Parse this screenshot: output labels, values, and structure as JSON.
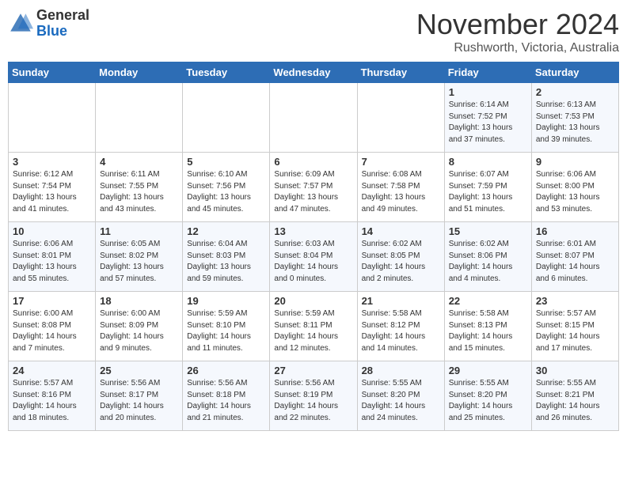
{
  "header": {
    "logo_general": "General",
    "logo_blue": "Blue",
    "month": "November 2024",
    "location": "Rushworth, Victoria, Australia"
  },
  "weekdays": [
    "Sunday",
    "Monday",
    "Tuesday",
    "Wednesday",
    "Thursday",
    "Friday",
    "Saturday"
  ],
  "weeks": [
    [
      {
        "day": "",
        "info": ""
      },
      {
        "day": "",
        "info": ""
      },
      {
        "day": "",
        "info": ""
      },
      {
        "day": "",
        "info": ""
      },
      {
        "day": "",
        "info": ""
      },
      {
        "day": "1",
        "info": "Sunrise: 6:14 AM\nSunset: 7:52 PM\nDaylight: 13 hours\nand 37 minutes."
      },
      {
        "day": "2",
        "info": "Sunrise: 6:13 AM\nSunset: 7:53 PM\nDaylight: 13 hours\nand 39 minutes."
      }
    ],
    [
      {
        "day": "3",
        "info": "Sunrise: 6:12 AM\nSunset: 7:54 PM\nDaylight: 13 hours\nand 41 minutes."
      },
      {
        "day": "4",
        "info": "Sunrise: 6:11 AM\nSunset: 7:55 PM\nDaylight: 13 hours\nand 43 minutes."
      },
      {
        "day": "5",
        "info": "Sunrise: 6:10 AM\nSunset: 7:56 PM\nDaylight: 13 hours\nand 45 minutes."
      },
      {
        "day": "6",
        "info": "Sunrise: 6:09 AM\nSunset: 7:57 PM\nDaylight: 13 hours\nand 47 minutes."
      },
      {
        "day": "7",
        "info": "Sunrise: 6:08 AM\nSunset: 7:58 PM\nDaylight: 13 hours\nand 49 minutes."
      },
      {
        "day": "8",
        "info": "Sunrise: 6:07 AM\nSunset: 7:59 PM\nDaylight: 13 hours\nand 51 minutes."
      },
      {
        "day": "9",
        "info": "Sunrise: 6:06 AM\nSunset: 8:00 PM\nDaylight: 13 hours\nand 53 minutes."
      }
    ],
    [
      {
        "day": "10",
        "info": "Sunrise: 6:06 AM\nSunset: 8:01 PM\nDaylight: 13 hours\nand 55 minutes."
      },
      {
        "day": "11",
        "info": "Sunrise: 6:05 AM\nSunset: 8:02 PM\nDaylight: 13 hours\nand 57 minutes."
      },
      {
        "day": "12",
        "info": "Sunrise: 6:04 AM\nSunset: 8:03 PM\nDaylight: 13 hours\nand 59 minutes."
      },
      {
        "day": "13",
        "info": "Sunrise: 6:03 AM\nSunset: 8:04 PM\nDaylight: 14 hours\nand 0 minutes."
      },
      {
        "day": "14",
        "info": "Sunrise: 6:02 AM\nSunset: 8:05 PM\nDaylight: 14 hours\nand 2 minutes."
      },
      {
        "day": "15",
        "info": "Sunrise: 6:02 AM\nSunset: 8:06 PM\nDaylight: 14 hours\nand 4 minutes."
      },
      {
        "day": "16",
        "info": "Sunrise: 6:01 AM\nSunset: 8:07 PM\nDaylight: 14 hours\nand 6 minutes."
      }
    ],
    [
      {
        "day": "17",
        "info": "Sunrise: 6:00 AM\nSunset: 8:08 PM\nDaylight: 14 hours\nand 7 minutes."
      },
      {
        "day": "18",
        "info": "Sunrise: 6:00 AM\nSunset: 8:09 PM\nDaylight: 14 hours\nand 9 minutes."
      },
      {
        "day": "19",
        "info": "Sunrise: 5:59 AM\nSunset: 8:10 PM\nDaylight: 14 hours\nand 11 minutes."
      },
      {
        "day": "20",
        "info": "Sunrise: 5:59 AM\nSunset: 8:11 PM\nDaylight: 14 hours\nand 12 minutes."
      },
      {
        "day": "21",
        "info": "Sunrise: 5:58 AM\nSunset: 8:12 PM\nDaylight: 14 hours\nand 14 minutes."
      },
      {
        "day": "22",
        "info": "Sunrise: 5:58 AM\nSunset: 8:13 PM\nDaylight: 14 hours\nand 15 minutes."
      },
      {
        "day": "23",
        "info": "Sunrise: 5:57 AM\nSunset: 8:15 PM\nDaylight: 14 hours\nand 17 minutes."
      }
    ],
    [
      {
        "day": "24",
        "info": "Sunrise: 5:57 AM\nSunset: 8:16 PM\nDaylight: 14 hours\nand 18 minutes."
      },
      {
        "day": "25",
        "info": "Sunrise: 5:56 AM\nSunset: 8:17 PM\nDaylight: 14 hours\nand 20 minutes."
      },
      {
        "day": "26",
        "info": "Sunrise: 5:56 AM\nSunset: 8:18 PM\nDaylight: 14 hours\nand 21 minutes."
      },
      {
        "day": "27",
        "info": "Sunrise: 5:56 AM\nSunset: 8:19 PM\nDaylight: 14 hours\nand 22 minutes."
      },
      {
        "day": "28",
        "info": "Sunrise: 5:55 AM\nSunset: 8:20 PM\nDaylight: 14 hours\nand 24 minutes."
      },
      {
        "day": "29",
        "info": "Sunrise: 5:55 AM\nSunset: 8:20 PM\nDaylight: 14 hours\nand 25 minutes."
      },
      {
        "day": "30",
        "info": "Sunrise: 5:55 AM\nSunset: 8:21 PM\nDaylight: 14 hours\nand 26 minutes."
      }
    ]
  ]
}
